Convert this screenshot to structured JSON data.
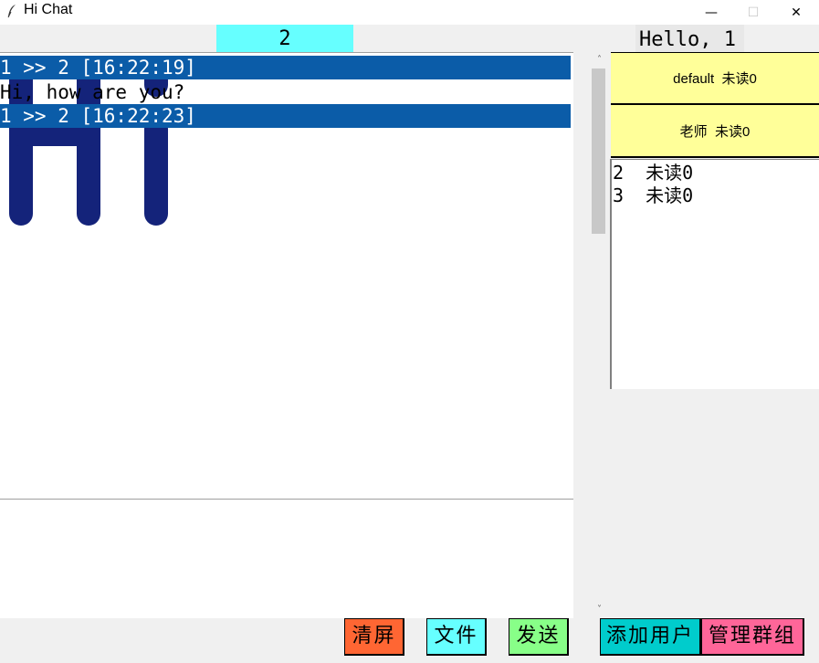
{
  "window": {
    "title": "Hi Chat",
    "minimize_glyph": "—",
    "maximize_glyph": "☐",
    "close_glyph": "✕"
  },
  "header": {
    "chat_target": "2",
    "greeting": "Hello, 1"
  },
  "messages": [
    {
      "header": "1 >> 2 [16:22:19]",
      "text": "Hi, how are you?"
    },
    {
      "header": "1 >> 2 [16:22:23]",
      "image_text": "Hi"
    }
  ],
  "scrollbar": {
    "up": "˄",
    "down": "˅"
  },
  "groups": [
    {
      "label": "default  未读0"
    },
    {
      "label": "老师  未读0"
    }
  ],
  "users": [
    {
      "label": "2  未读0"
    },
    {
      "label": "3  未读0"
    }
  ],
  "buttons": {
    "clear": "清屏",
    "file": "文件",
    "send": "发送",
    "add_user": "添加用户",
    "manage_group": "管理群组"
  },
  "colors": {
    "message_header_bg": "#0b5ca8",
    "big_text": "#14237a",
    "group_bg": "#ffff99"
  }
}
